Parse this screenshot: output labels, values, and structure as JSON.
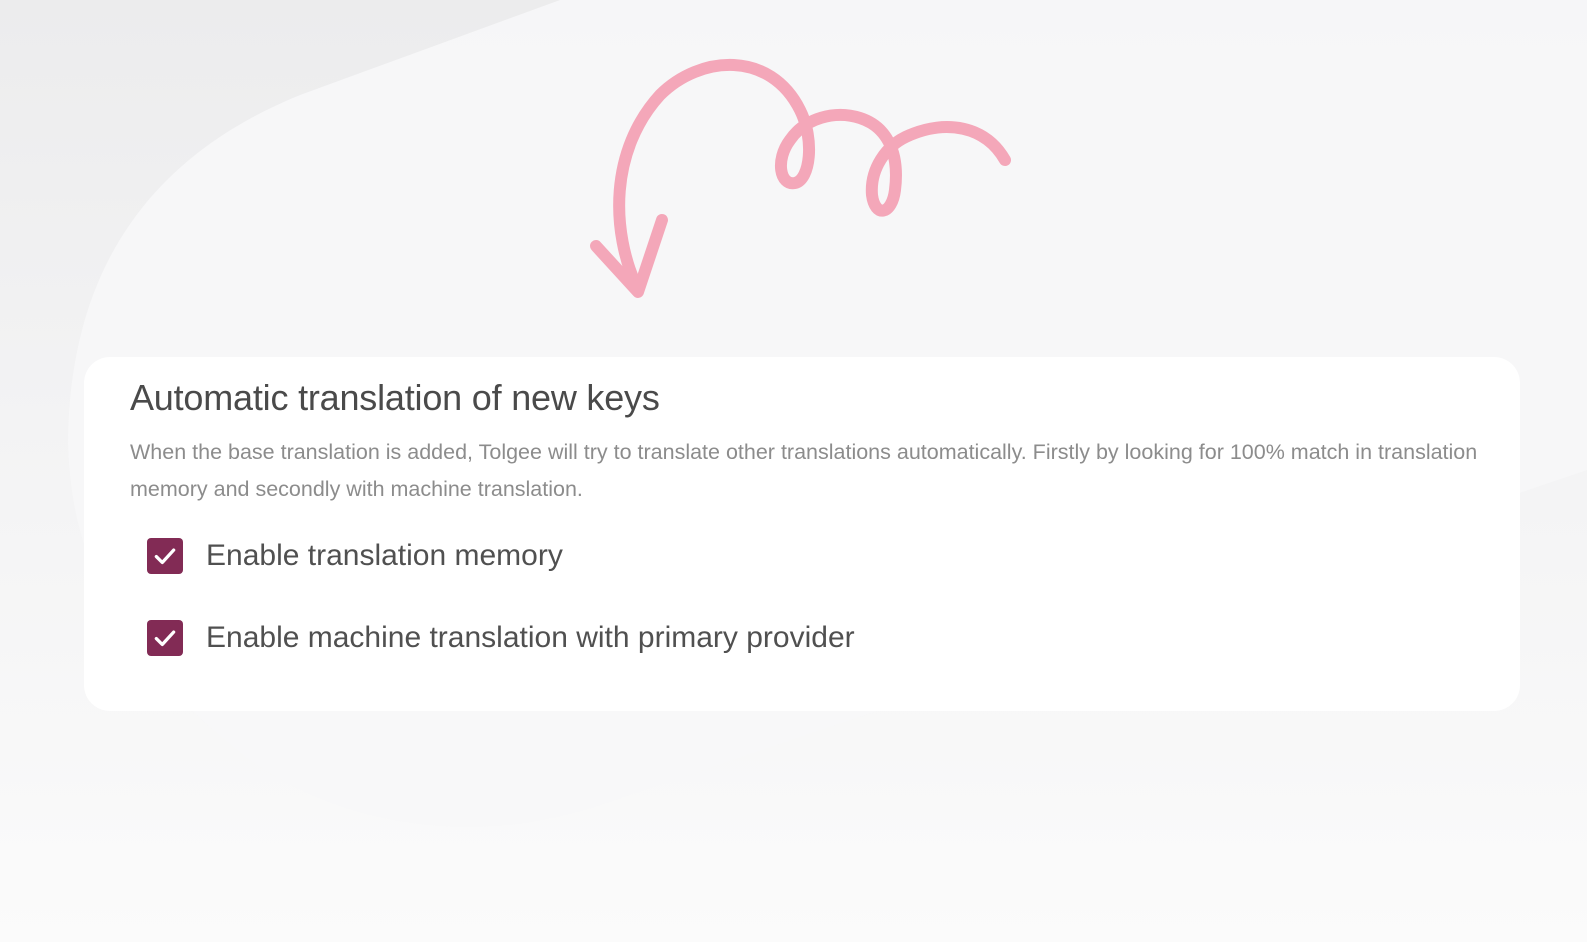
{
  "settings": {
    "title": "Automatic translation of new keys",
    "description": "When the base translation is added, Tolgee will try to translate other translations automatically. Firstly by looking for 100% match in translation memory and secondly with machine translation.",
    "options": [
      {
        "label": "Enable translation memory",
        "checked": true
      },
      {
        "label": "Enable machine translation with primary provider",
        "checked": true
      }
    ]
  },
  "colors": {
    "accent": "#822b55",
    "doodle": "#f4a7b9",
    "card": "#ffffff"
  },
  "icons": {
    "checkbox": "checkmark-icon",
    "doodle": "curly-arrow-icon"
  }
}
